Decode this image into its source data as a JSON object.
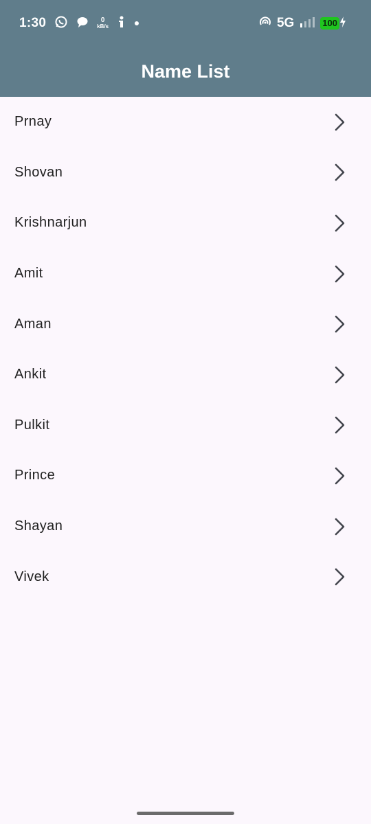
{
  "status_bar": {
    "time": "1:30",
    "net_speed_value": "0",
    "net_speed_unit": "kB/s",
    "network": "5G",
    "battery": "100"
  },
  "app_bar": {
    "title": "Name List",
    "background_color": "#607D8B"
  },
  "names": [
    {
      "label": "Prnay"
    },
    {
      "label": "Shovan"
    },
    {
      "label": "Krishnarjun"
    },
    {
      "label": "Amit"
    },
    {
      "label": "Aman"
    },
    {
      "label": "Ankit"
    },
    {
      "label": "Pulkit"
    },
    {
      "label": "Prince"
    },
    {
      "label": "Shayan"
    },
    {
      "label": "Vivek"
    }
  ],
  "icons": {
    "row_trailing": "chevron-right-icon"
  }
}
